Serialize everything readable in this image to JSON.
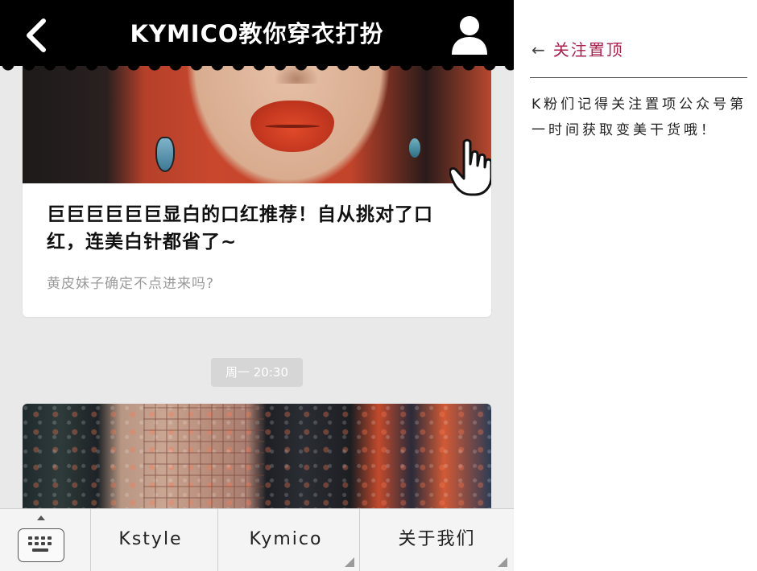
{
  "header": {
    "title": "KYMICO教你穿衣打扮",
    "back_icon": "chevron-left-icon",
    "profile_icon": "user-icon"
  },
  "feed": {
    "article1": {
      "title": "巨巨巨巨巨巨显白的口红推荐！自从挑对了口红，连美白针都省了~",
      "subtitle": "黄皮妹子确定不点进来吗?"
    },
    "timestamp": "周一 20:30"
  },
  "bottom_menu": {
    "keyboard_icon": "keyboard-icon",
    "items": [
      {
        "label": "Kstyle"
      },
      {
        "label": "Kymico"
      },
      {
        "label": "关于我们"
      }
    ]
  },
  "side_panel": {
    "arrow": "←",
    "header": "关注置顶",
    "body": "K粉们记得关注置项公众号第一时间获取变美干货哦！"
  },
  "colors": {
    "accent": "#a8204c",
    "topbar": "#000000",
    "feed_bg": "#e9e9e9"
  }
}
